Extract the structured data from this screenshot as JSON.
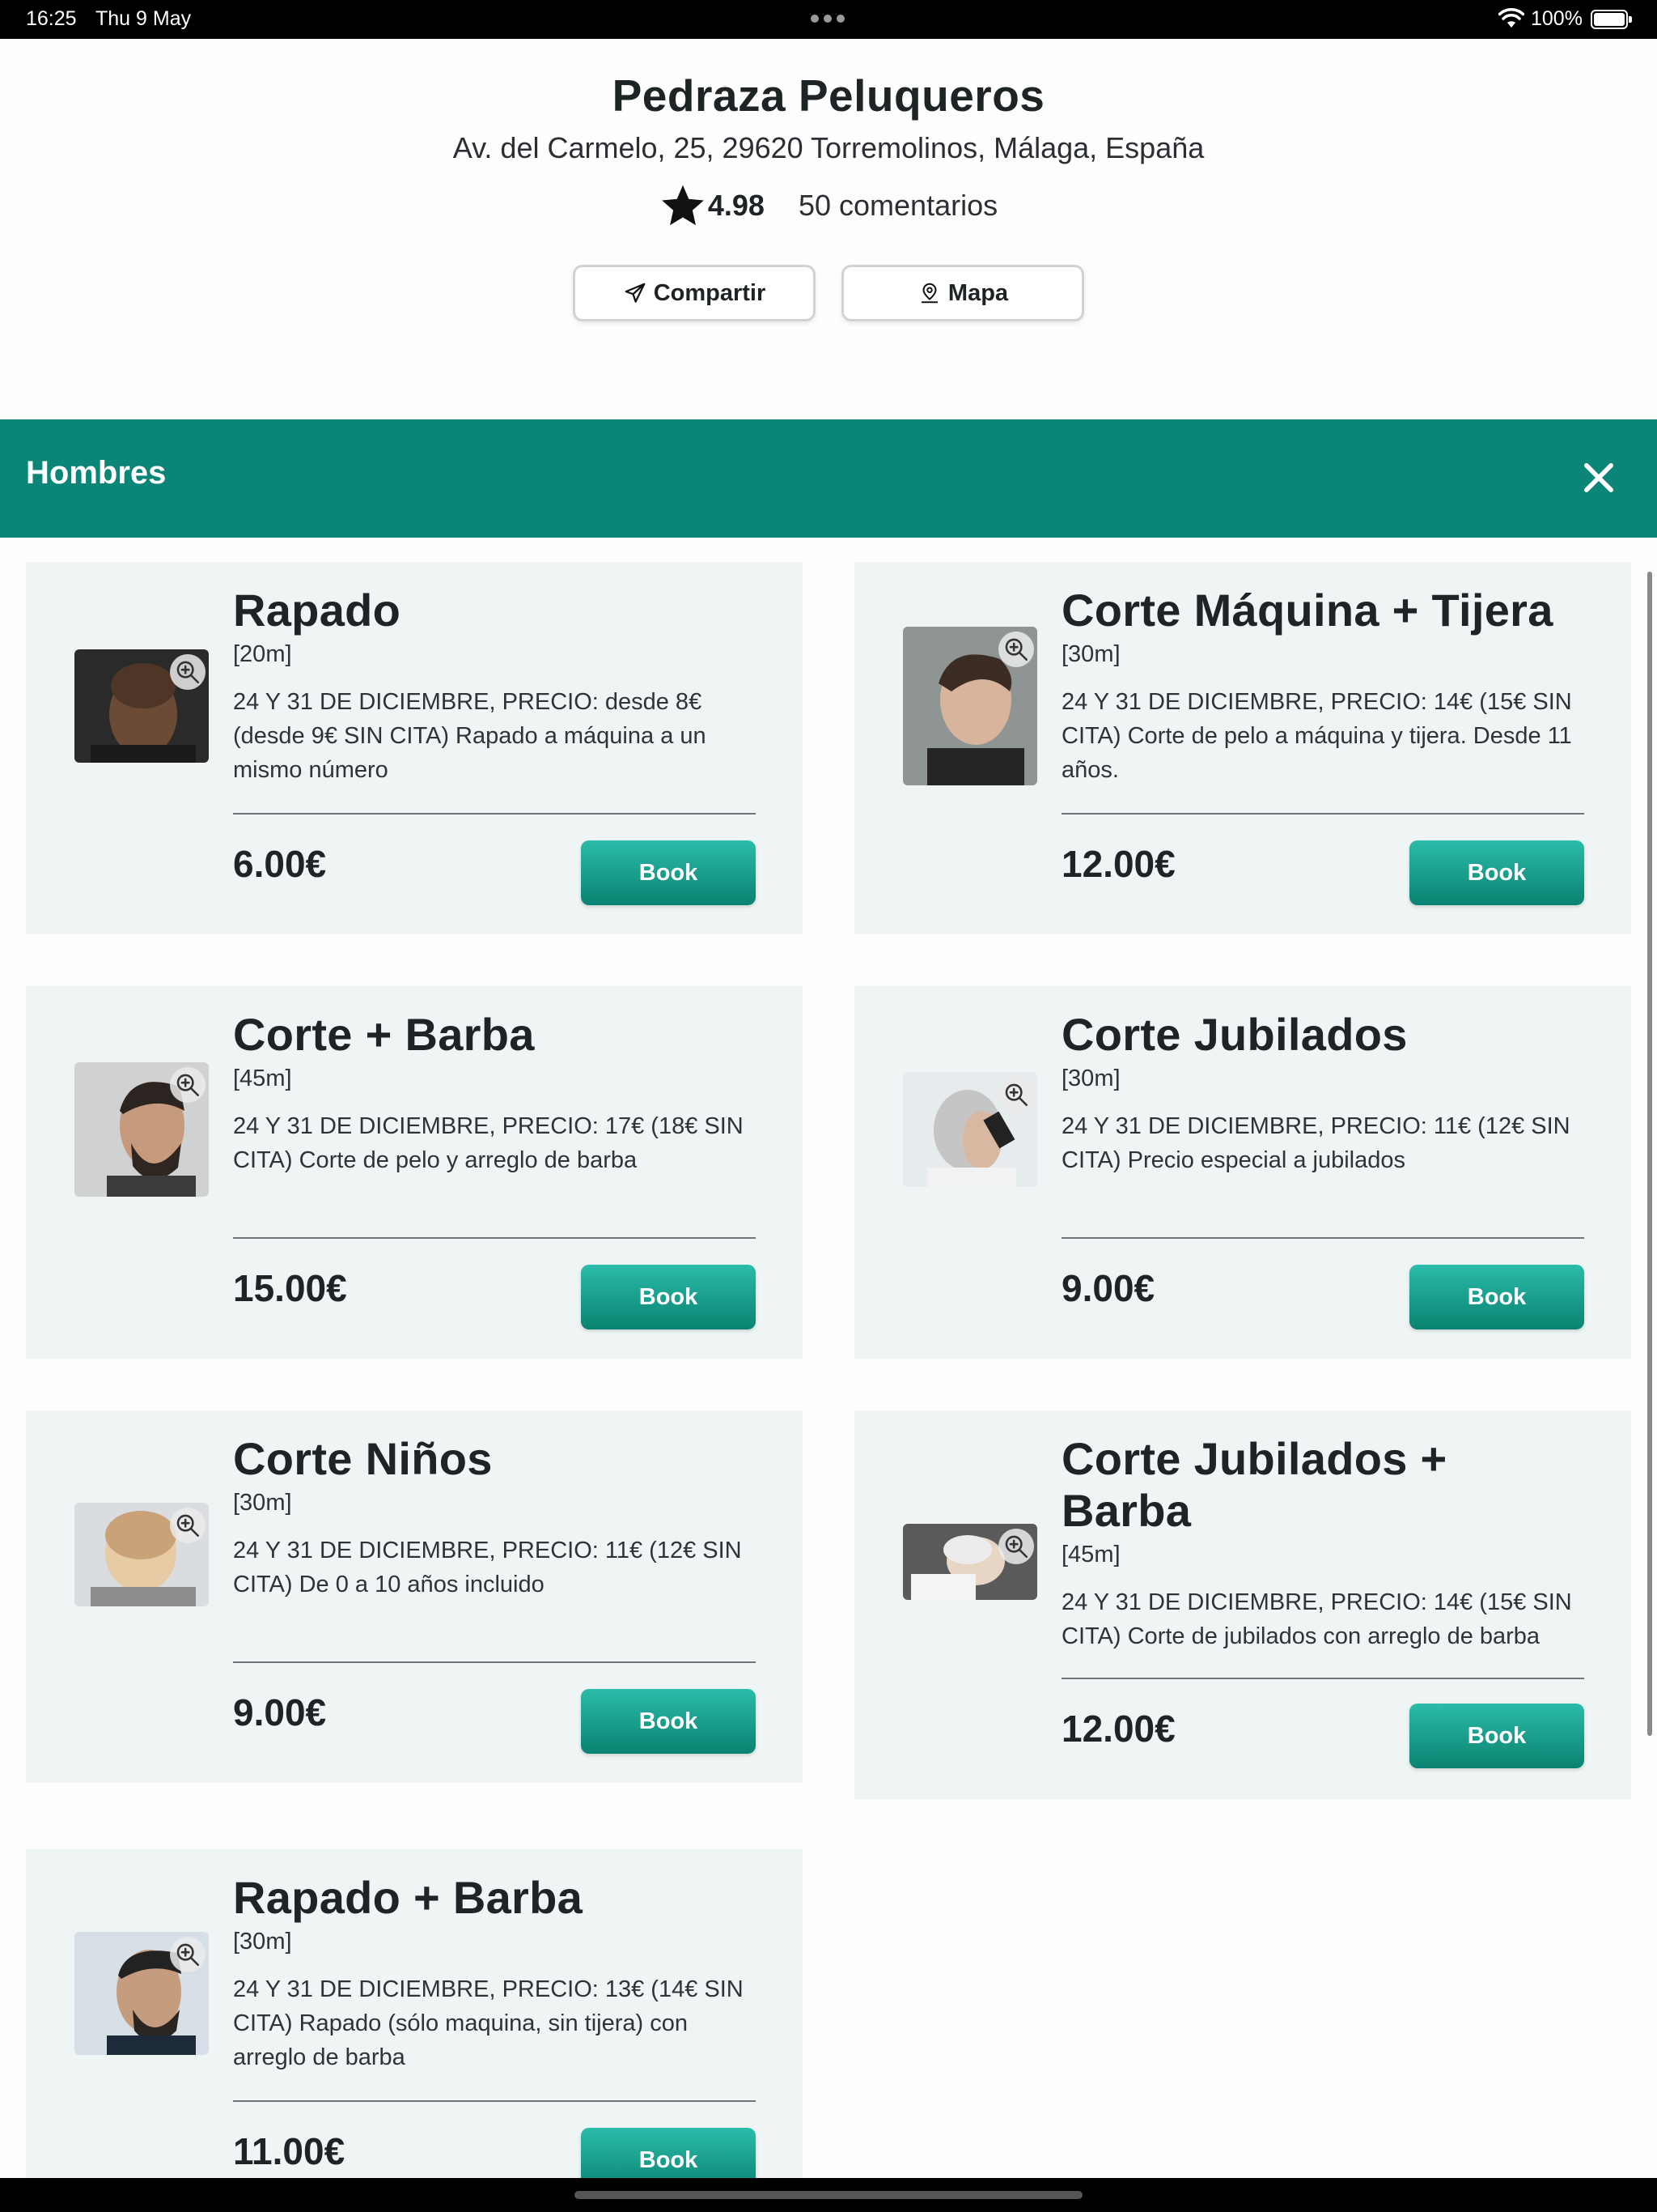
{
  "status_bar": {
    "time": "16:25",
    "date": "Thu 9 May",
    "battery": "100%"
  },
  "business": {
    "name": "Pedraza Peluqueros",
    "address": "Av. del Carmelo, 25, 29620 Torremolinos, Málaga, España",
    "rating": "4.98",
    "reviews": "50 comentarios",
    "share_label": "Compartir",
    "map_label": "Mapa"
  },
  "section": {
    "title": "Hombres"
  },
  "services": [
    {
      "title": "Rapado",
      "duration": "[20m]",
      "description": "24 Y 31 DE DICIEMBRE, PRECIO: desde 8€ (desde 9€ SIN CITA) Rapado a máquina a un mismo número",
      "price": "6.00€",
      "book_label": "Book"
    },
    {
      "title": "Corte Máquina + Tijera",
      "duration": "[30m]",
      "description": "24 Y 31 DE DICIEMBRE, PRECIO: 14€ (15€ SIN CITA) Corte de pelo a máquina y tijera. Desde 11 años.",
      "price": "12.00€",
      "book_label": "Book"
    },
    {
      "title": "Corte + Barba",
      "duration": "[45m]",
      "description": "24 Y 31 DE DICIEMBRE, PRECIO: 17€ (18€ SIN CITA) Corte de pelo y arreglo de barba",
      "price": "15.00€",
      "book_label": "Book"
    },
    {
      "title": "Corte Jubilados",
      "duration": "[30m]",
      "description": "24 Y 31 DE DICIEMBRE, PRECIO: 11€ (12€ SIN CITA) Precio especial a jubilados",
      "price": "9.00€",
      "book_label": "Book"
    },
    {
      "title": "Corte Niños",
      "duration": "[30m]",
      "description": "24 Y 31 DE DICIEMBRE, PRECIO: 11€ (12€ SIN CITA) De 0 a 10 años incluido",
      "price": "9.00€",
      "book_label": "Book"
    },
    {
      "title": "Corte Jubilados + Barba",
      "duration": "[45m]",
      "description": "24 Y 31 DE DICIEMBRE, PRECIO: 14€ (15€ SIN CITA) Corte de jubilados con arreglo de barba",
      "price": "12.00€",
      "book_label": "Book"
    },
    {
      "title": "Rapado + Barba",
      "duration": "[30m]",
      "description": "24 Y 31 DE DICIEMBRE, PRECIO: 13€ (14€ SIN CITA) Rapado (sólo maquina, sin tijera) con arreglo de barba",
      "price": "11.00€",
      "book_label": "Book"
    }
  ],
  "colors": {
    "accent": "#0b8575",
    "card_bg": "#eef5f4",
    "book_gradient_top": "#2bbca9",
    "book_gradient_bottom": "#0a8271"
  }
}
